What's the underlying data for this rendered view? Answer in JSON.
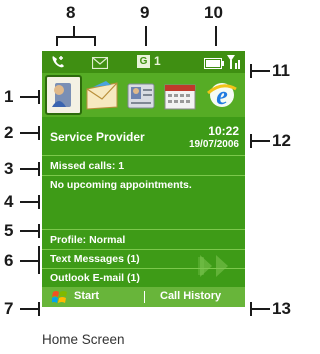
{
  "callouts": {
    "c1": "1",
    "c2": "2",
    "c3": "3",
    "c4": "4",
    "c5": "5",
    "c6": "6",
    "c7": "7",
    "c8": "8",
    "c9": "9",
    "c10": "10",
    "c11": "11",
    "c12": "12",
    "c13": "13"
  },
  "status_bar": {
    "indicator_g": "G",
    "indicator_1": "1"
  },
  "today": {
    "service_provider": "Service Provider",
    "time": "10:22",
    "date": "19/07/2006",
    "missed_calls": "Missed calls: 1",
    "appointments": "No upcoming appointments.",
    "profile": "Profile: Normal",
    "text_messages": "Text Messages (1)",
    "outlook_email": "Outlook E-mail (1)"
  },
  "softkeys": {
    "left": "Start",
    "right": "Call History"
  },
  "caption": "Home Screen",
  "icons": [
    "phone-contact-icon",
    "envelope-icon",
    "contact-card-icon",
    "calendar-icon",
    "internet-explorer-icon"
  ],
  "colors": {
    "screen_bg": "#3e9b17",
    "icon_row_bg": "#56ac25",
    "softkey_bar_bg": "#68b53a"
  }
}
